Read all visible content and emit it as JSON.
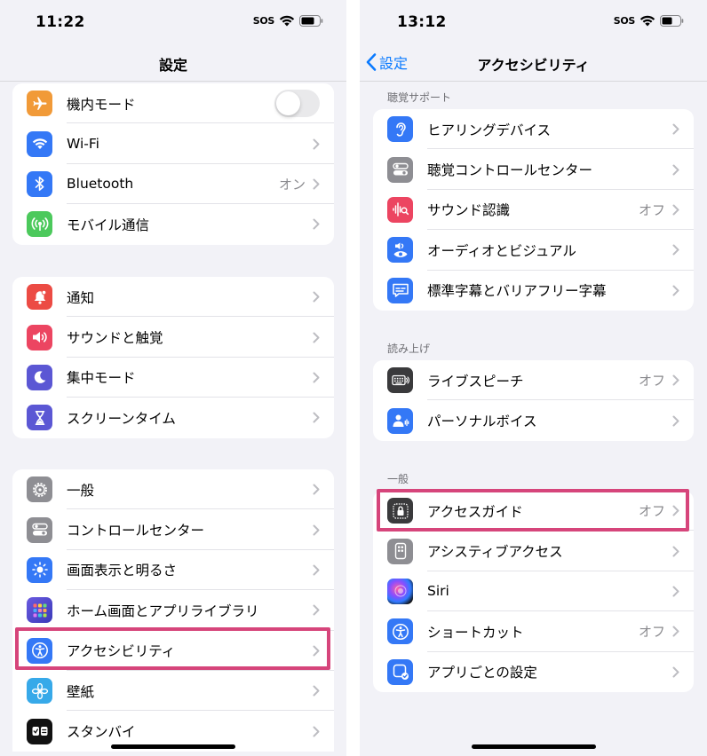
{
  "left": {
    "status": {
      "time": "11:22",
      "sos": "SOS"
    },
    "nav": {
      "title": "設定"
    },
    "groups": [
      {
        "items": [
          {
            "label": "機内モード",
            "toggle": "off"
          },
          {
            "label": "Wi-Fi"
          },
          {
            "label": "Bluetooth",
            "value": "オン"
          },
          {
            "label": "モバイル通信"
          }
        ]
      },
      {
        "items": [
          {
            "label": "通知"
          },
          {
            "label": "サウンドと触覚"
          },
          {
            "label": "集中モード"
          },
          {
            "label": "スクリーンタイム"
          }
        ]
      },
      {
        "items": [
          {
            "label": "一般"
          },
          {
            "label": "コントロールセンター"
          },
          {
            "label": "画面表示と明るさ"
          },
          {
            "label": "ホーム画面とアプリライブラリ"
          },
          {
            "label": "アクセシビリティ",
            "highlighted": true
          },
          {
            "label": "壁紙"
          },
          {
            "label": "スタンバイ"
          }
        ]
      }
    ]
  },
  "right": {
    "status": {
      "time": "13:12",
      "sos": "SOS"
    },
    "nav": {
      "back_label": "設定",
      "title": "アクセシビリティ"
    },
    "sections": [
      {
        "header": "聴覚サポート",
        "items": [
          {
            "label": "ヒアリングデバイス"
          },
          {
            "label": "聴覚コントロールセンター"
          },
          {
            "label": "サウンド認識",
            "value": "オフ"
          },
          {
            "label": "オーディオとビジュアル"
          },
          {
            "label": "標準字幕とバリアフリー字幕"
          }
        ]
      },
      {
        "header": "読み上げ",
        "items": [
          {
            "label": "ライブスピーチ",
            "value": "オフ"
          },
          {
            "label": "パーソナルボイス"
          }
        ]
      },
      {
        "header": "一般",
        "items": [
          {
            "label": "アクセスガイド",
            "value": "オフ",
            "highlighted": true
          },
          {
            "label": "アシスティブアクセス"
          },
          {
            "label": "Siri"
          },
          {
            "label": "ショートカット",
            "value": "オフ"
          },
          {
            "label": "アプリごとの設定"
          }
        ]
      }
    ]
  },
  "colors": {
    "highlight": "#d6457b",
    "link": "#0a7aff",
    "secondary_text": "#8a8a8e"
  }
}
